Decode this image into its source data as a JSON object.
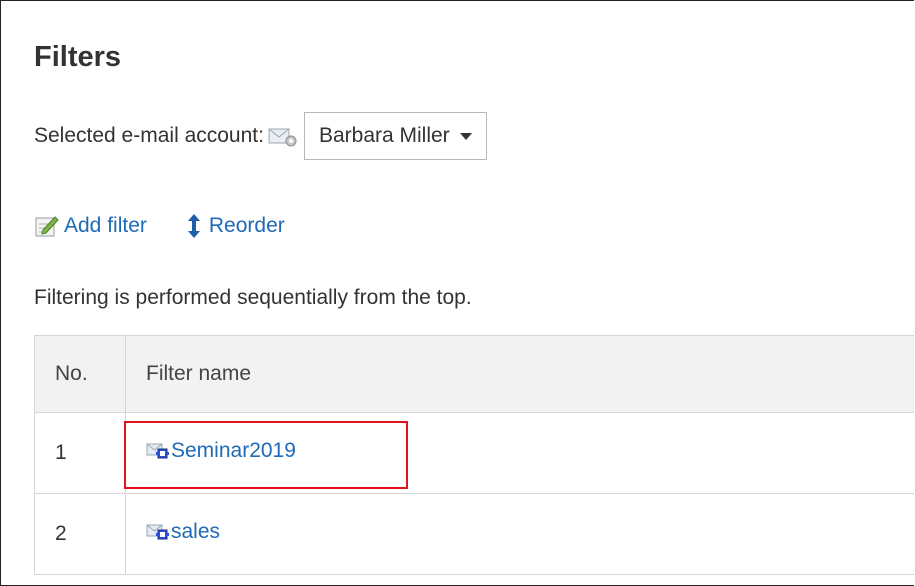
{
  "page": {
    "title": "Filters"
  },
  "account": {
    "label": "Selected e-mail account:",
    "selected": "Barbara Miller"
  },
  "actions": {
    "add_filter": "Add filter",
    "reorder": "Reorder"
  },
  "hint": "Filtering is performed sequentially from the top.",
  "table": {
    "columns": {
      "no": "No.",
      "name": "Filter name"
    },
    "rows": [
      {
        "no": "1",
        "name": "Seminar2019"
      },
      {
        "no": "2",
        "name": "sales"
      }
    ]
  },
  "colors": {
    "link": "#1f6ab8",
    "highlight": "#e0121b",
    "header_bg": "#f2f2f2"
  }
}
